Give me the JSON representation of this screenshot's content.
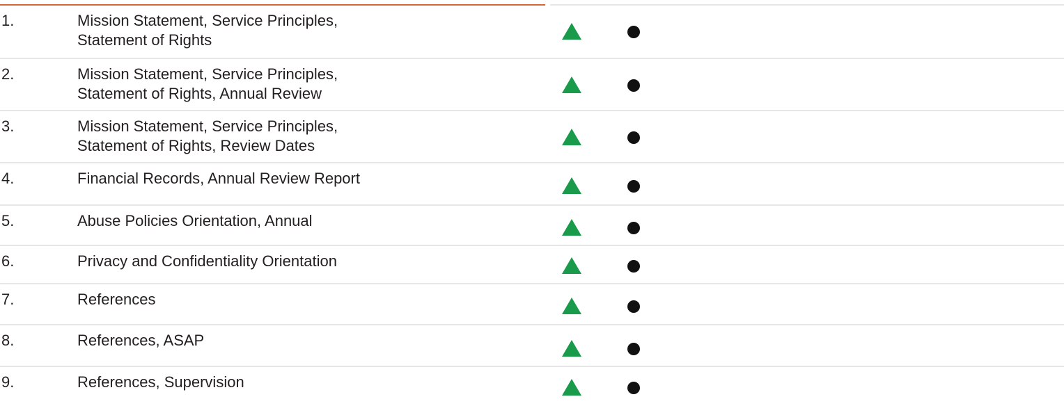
{
  "colors": {
    "triangle": "#1a9a4b",
    "dot": "#111111",
    "header_rule": "#d9623a"
  },
  "icons": {
    "marker_a": "green-triangle-icon",
    "marker_b": "black-dot-icon"
  },
  "rows": [
    {
      "number": "1.",
      "lines": [
        "Mission Statement, Service Principles,",
        "Statement of Rights"
      ]
    },
    {
      "number": "2.",
      "lines": [
        "Mission Statement, Service Principles,",
        "Statement of Rights, Annual Review"
      ]
    },
    {
      "number": "3.",
      "lines": [
        "Mission Statement, Service Principles,",
        "Statement of Rights, Review Dates"
      ]
    },
    {
      "number": "4.",
      "lines": [
        "Financial Records, Annual Review Report"
      ]
    },
    {
      "number": "5.",
      "lines": [
        "Abuse Policies Orientation, Annual"
      ]
    },
    {
      "number": "6.",
      "lines": [
        "Privacy and Confidentiality Orientation"
      ]
    },
    {
      "number": "7.",
      "lines": [
        "References"
      ]
    },
    {
      "number": "8.",
      "lines": [
        "References, ASAP"
      ]
    },
    {
      "number": "9.",
      "lines": [
        "References, Supervision"
      ]
    }
  ]
}
